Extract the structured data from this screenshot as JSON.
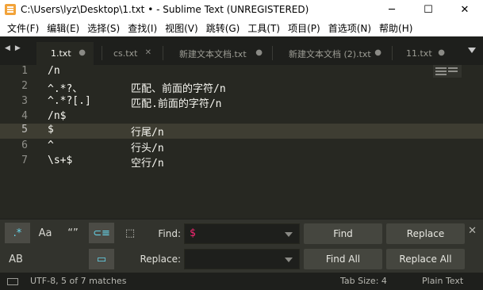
{
  "window": {
    "title": "C:\\Users\\lyz\\Desktop\\1.txt • - Sublime Text (UNREGISTERED)",
    "minimize_glyph": "─",
    "maximize_glyph": "☐",
    "close_glyph": "✕"
  },
  "menu": [
    "文件(F)",
    "编辑(E)",
    "选择(S)",
    "查找(I)",
    "视图(V)",
    "跳转(G)",
    "工具(T)",
    "项目(P)",
    "首选项(N)",
    "帮助(H)"
  ],
  "tab_nav": {
    "prev": "◀",
    "next": "▶"
  },
  "tabs": [
    {
      "label": "1.txt",
      "ctl": "●",
      "active": true
    },
    {
      "label": "cs.txt",
      "ctl": "✕",
      "active": false
    },
    {
      "label": "新建文本文档.txt",
      "ctl": "●",
      "active": false
    },
    {
      "label": "新建文本文档 (2).txt",
      "ctl": "●",
      "active": false
    },
    {
      "label": "11.txt",
      "ctl": "●",
      "active": false
    }
  ],
  "editor": {
    "current_line": 5,
    "lines": [
      {
        "num": "1",
        "a": "/n",
        "b": ""
      },
      {
        "num": "2",
        "a": "^.*?、",
        "b": "匹配、前面的字符/n"
      },
      {
        "num": "3",
        "a": "^.*?[.]",
        "b": "匹配.前面的字符/n"
      },
      {
        "num": "4",
        "a": "/n$",
        "b": ""
      },
      {
        "num": "5",
        "a": "$",
        "b": "行尾/n"
      },
      {
        "num": "6",
        "a": "^",
        "b": "行头/n"
      },
      {
        "num": "7",
        "a": "\\s+$",
        "b": "空行/n"
      }
    ]
  },
  "find": {
    "options": {
      "regex": ".*",
      "case": "Aa",
      "whole_word": "“”",
      "wrap": "⊂≡",
      "in_selection": "⬚",
      "preserve_case": "AB",
      "highlight": "▭"
    },
    "find_label": "Find:",
    "find_value": "$",
    "replace_label": "Replace:",
    "replace_value": "",
    "find_button": "Find",
    "replace_button": "Replace",
    "find_all_button": "Find All",
    "replace_all_button": "Replace All",
    "close_glyph": "✕"
  },
  "status": {
    "left": "UTF-8, 5 of 7 matches",
    "tab_size": "Tab Size: 4",
    "syntax": "Plain Text"
  },
  "colors": {
    "editor_bg": "#272822",
    "current_line_bg": "#3e3d32",
    "find_panel_bg": "#32332d",
    "status_bg": "#1e1f1c",
    "accent_regex": "#66d9ef",
    "find_value": "#f92672"
  }
}
